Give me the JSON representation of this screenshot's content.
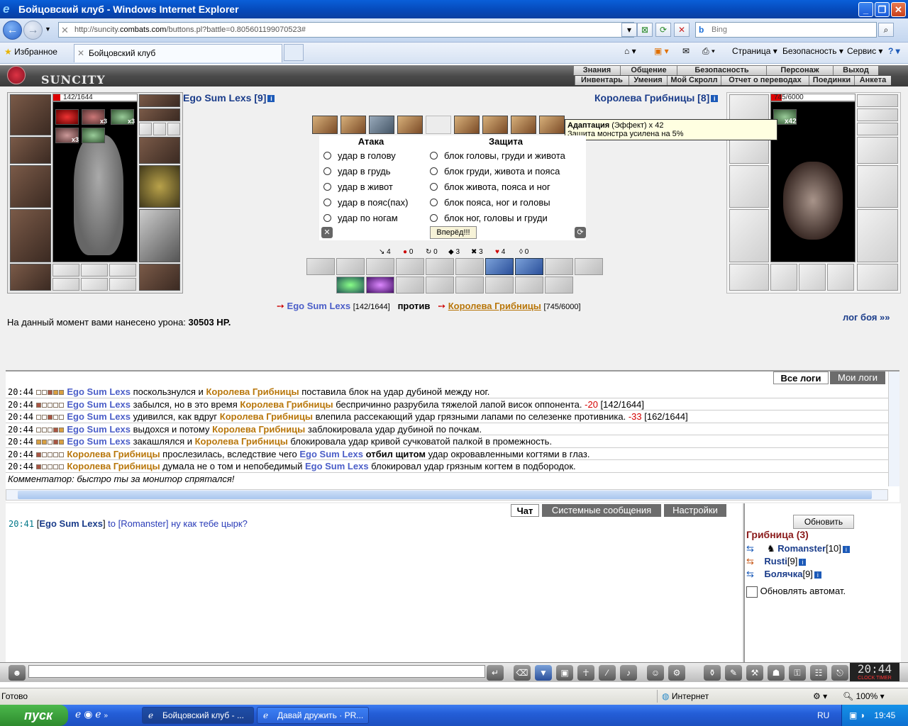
{
  "window": {
    "title": "Бойцовский клуб - Windows Internet Explorer",
    "url_prefix": "http://suncity.",
    "url_domain": "combats.com",
    "url_path": "/buttons.pl?battle=0.805601199070523#",
    "search_placeholder": "Bing",
    "favorites_label": "Избранное",
    "tab_title": "Бойцовский клуб",
    "cmd_page": "Страница",
    "cmd_security": "Безопасность",
    "cmd_service": "Сервис"
  },
  "game_menu": {
    "logo": "SUNCITY",
    "row1": [
      "Знания",
      "Общение",
      "Безопасность",
      "Персонаж",
      "Выход"
    ],
    "row2": [
      "Инвентарь",
      "Умения",
      "Мой Скролл",
      "Отчет о переводах",
      "Поединки",
      "Анкета"
    ]
  },
  "player": {
    "name": "Ego Sum Lexs [9]",
    "hp": "142/1644",
    "hp_fraction": 0.086,
    "buff_counts": [
      "x3",
      "x3",
      "x3"
    ]
  },
  "opponent": {
    "name": "Королева Грибницы [8]",
    "hp": "745/6000",
    "hp_fraction": 0.124,
    "buff_count": "x42"
  },
  "tooltip": {
    "title": "Адаптация",
    "effect": " (Эффект) x 42",
    "desc": "Защита монстра усилена на 5%"
  },
  "attack": {
    "header": "Атака",
    "options": [
      "удар в голову",
      "удар в грудь",
      "удар в живот",
      "удар в пояс(пах)",
      "удар по ногам"
    ]
  },
  "defense": {
    "header": "Защита",
    "options": [
      "блок головы, груди и живота",
      "блок груди, живота и пояса",
      "блок живота, пояса и ног",
      "блок пояса, ног и головы",
      "блок ног, головы и груди"
    ]
  },
  "go_button": "Вперёд!!!",
  "stats": [
    "4",
    "0",
    "0",
    "3",
    "3",
    "4",
    "0"
  ],
  "versus": {
    "me": "Ego Sum Lexs",
    "me_hp": "[142/1644]",
    "vs": "против",
    "enemy": "Королева Грибницы",
    "enemy_hp": "[745/6000]"
  },
  "damage": {
    "label": "На данный момент вами нанесено урона:",
    "value": "30503 HP."
  },
  "log_link": "лог боя »»",
  "log_tabs": [
    "Все логи",
    "Мои логи"
  ],
  "log_lines": [
    {
      "time": "20:44",
      "a": "Ego Sum Lexs",
      "a_cls": "blue",
      "t1": " поскользнулся и ",
      "b": "Королева Грибницы",
      "b_cls": "orange",
      "t2": " поставила блок на удар дубиной между ног.",
      "dmg": "",
      "hp": ""
    },
    {
      "time": "20:44",
      "a": "Ego Sum Lexs",
      "a_cls": "blue",
      "t1": " забылся, но в это время ",
      "b": "Королева Грибницы",
      "b_cls": "orange",
      "t2": " беспричинно разрубила тяжелой лапой висок оппонента. ",
      "dmg": "-20",
      "hp": " [142/1644]"
    },
    {
      "time": "20:44",
      "a": "Ego Sum Lexs",
      "a_cls": "blue",
      "t1": " удивился, как вдруг ",
      "b": "Королева Грибницы",
      "b_cls": "orange",
      "t2": " влепила рассекающий удар грязными лапами по селезенке противника. ",
      "dmg": "-33",
      "hp": " [162/1644]"
    },
    {
      "time": "20:44",
      "a": "Ego Sum Lexs",
      "a_cls": "blue",
      "t1": " выдохся и потому ",
      "b": "Королева Грибницы",
      "b_cls": "orange",
      "t2": " заблокировала удар дубиной по почкам.",
      "dmg": "",
      "hp": ""
    },
    {
      "time": "20:44",
      "a": "Ego Sum Lexs",
      "a_cls": "blue",
      "t1": " закашлялся и ",
      "b": "Королева Грибницы",
      "b_cls": "orange",
      "t2": " блокировала удар кривой сучковатой палкой в промежность.",
      "dmg": "",
      "hp": ""
    },
    {
      "time": "20:44",
      "a": "Королева Грибницы",
      "a_cls": "orange",
      "t1": " прослезилась, вследствие чего ",
      "b": "Ego Sum Lexs",
      "b_cls": "blue",
      "t2": " удар окровавленными когтями в глаз.",
      "bold": " отбил щитом",
      "dmg": "",
      "hp": ""
    },
    {
      "time": "20:44",
      "a": "Королева Грибницы",
      "a_cls": "orange",
      "t1": " думала не о том и непобедимый ",
      "b": "Ego Sum Lexs",
      "b_cls": "blue",
      "t2": " блокировал удар грязным когтем в подбородок.",
      "dmg": "",
      "hp": ""
    }
  ],
  "commentator": "Комментатор: быстро ты за монитор спрятался!",
  "chat_tabs": [
    "Чат",
    "Системные сообщения",
    "Настройки"
  ],
  "chat_message": {
    "time": "20:41",
    "from": "Ego Sum Lexs",
    "to_word": " to ",
    "to": "[Romanster]",
    "text": " ну как тебе цырк?"
  },
  "online": {
    "refresh": "Обновить",
    "room": "Грибница (3)",
    "users": [
      {
        "name": "Romanster",
        "level": "[10]"
      },
      {
        "name": "Rusti",
        "level": "[9]"
      },
      {
        "name": "Болячка",
        "level": "[9]"
      }
    ],
    "auto_refresh": "Обновлять автомат."
  },
  "clock": "20:44",
  "clock_label": "CLOCK TIMER",
  "status": {
    "left": "Готово",
    "zone": "Интернет",
    "zoom": "100%"
  },
  "taskbar": {
    "start": "пуск",
    "task1": "Бойцовский клуб - ...",
    "task2": "Давай дружить · PR...",
    "lang": "RU",
    "time": "19:45"
  }
}
